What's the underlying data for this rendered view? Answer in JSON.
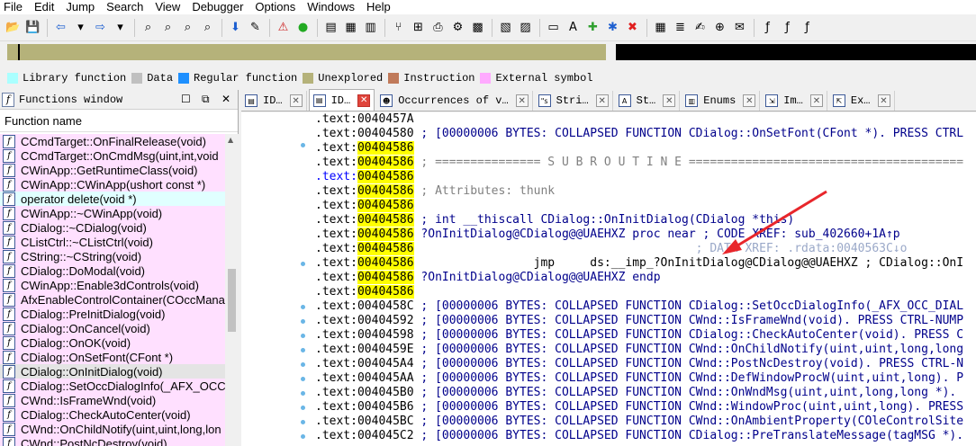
{
  "menu": [
    "File",
    "Edit",
    "Jump",
    "Search",
    "View",
    "Debugger",
    "Options",
    "Windows",
    "Help"
  ],
  "toolbar_icons": [
    "open-icon",
    "save-icon",
    "sep",
    "back-icon",
    "back-dropdown-icon",
    "forward-icon",
    "forward-dropdown-icon",
    "sep",
    "binary-search-icon",
    "text-search-icon",
    "search-next-icon",
    "search-immediate-icon",
    "sep",
    "jump-down-icon",
    "xref-icon",
    "sep",
    "warning-icon",
    "debug-run-icon",
    "sep",
    "hex-view-icon",
    "structures-icon",
    "enums-icon",
    "sep",
    "calls-icon",
    "graph-icon",
    "print-icon",
    "wingraph-icon",
    "colors-icon",
    "sep",
    "strings-view-icon",
    "names-view-icon",
    "sep",
    "add-segment-icon",
    "text-a-icon",
    "patch-icon",
    "add-breakpoint-icon",
    "stop-icon",
    "sep",
    "calculator-icon",
    "list-icon",
    "text-editor-icon",
    "search-plus-icon",
    "note-icon",
    "sep",
    "function-icon",
    "script-icon",
    "python-icon"
  ],
  "legend": [
    {
      "label": "Library function",
      "color": "#aaffff"
    },
    {
      "label": "Data",
      "color": "#c0c0c0"
    },
    {
      "label": "Regular function",
      "color": "#1e90ff"
    },
    {
      "label": "Unexplored",
      "color": "#b5b27a"
    },
    {
      "label": "Instruction",
      "color": "#c07a5a"
    },
    {
      "label": "External symbol",
      "color": "#ffaaff"
    }
  ],
  "functions_window": {
    "title": "Functions window",
    "column_header": "Function name",
    "items": [
      {
        "name": "CCmdTarget::OnFinalRelease(void)",
        "kind": "regular"
      },
      {
        "name": "CCmdTarget::OnCmdMsg(uint,int,void",
        "kind": "regular"
      },
      {
        "name": "CWinApp::GetRuntimeClass(void)",
        "kind": "regular"
      },
      {
        "name": "CWinApp::CWinApp(ushort const *)",
        "kind": "regular"
      },
      {
        "name": "operator delete(void *)",
        "kind": "library"
      },
      {
        "name": "CWinApp::~CWinApp(void)",
        "kind": "regular"
      },
      {
        "name": "CDialog::~CDialog(void)",
        "kind": "regular"
      },
      {
        "name": "CListCtrl::~CListCtrl(void)",
        "kind": "regular"
      },
      {
        "name": "CString::~CString(void)",
        "kind": "regular"
      },
      {
        "name": "CDialog::DoModal(void)",
        "kind": "regular"
      },
      {
        "name": "CWinApp::Enable3dControls(void)",
        "kind": "regular"
      },
      {
        "name": "AfxEnableControlContainer(COccMana",
        "kind": "regular"
      },
      {
        "name": "CDialog::PreInitDialog(void)",
        "kind": "regular"
      },
      {
        "name": "CDialog::OnCancel(void)",
        "kind": "regular"
      },
      {
        "name": "CDialog::OnOK(void)",
        "kind": "regular"
      },
      {
        "name": "CDialog::OnSetFont(CFont *)",
        "kind": "regular"
      },
      {
        "name": "CDialog::OnInitDialog(void)",
        "kind": "selected"
      },
      {
        "name": "CDialog::SetOccDialogInfo(_AFX_OCC_I",
        "kind": "regular"
      },
      {
        "name": "CWnd::IsFrameWnd(void)",
        "kind": "regular"
      },
      {
        "name": "CDialog::CheckAutoCenter(void)",
        "kind": "regular"
      },
      {
        "name": "CWnd::OnChildNotify(uint,uint,long,lon",
        "kind": "regular"
      },
      {
        "name": "CWnd::PostNcDestroy(void)",
        "kind": "regular"
      }
    ]
  },
  "tabs": [
    {
      "label": "ID…",
      "icon": "ida-view-icon",
      "active": false
    },
    {
      "label": "ID…",
      "icon": "ida-view-icon",
      "active": true
    },
    {
      "label": "Occurrences of v…",
      "icon": "occurrences-icon",
      "active": false
    },
    {
      "label": "Stri…",
      "icon": "strings-icon",
      "active": false
    },
    {
      "label": "St…",
      "icon": "structures-icon",
      "active": false
    },
    {
      "label": "Enums",
      "icon": "enums-icon",
      "active": false
    },
    {
      "label": "Im…",
      "icon": "imports-icon",
      "active": false
    },
    {
      "label": "Ex…",
      "icon": "exports-icon",
      "active": false
    }
  ],
  "disassembly": [
    {
      "seg": ".text:",
      "addr": "0040457A",
      "hl": false,
      "segblue": false,
      "bullet": false,
      "code": ""
    },
    {
      "seg": ".text:",
      "addr": "00404580",
      "hl": false,
      "segblue": false,
      "bullet": true,
      "code": " ; [00000006 BYTES: COLLAPSED FUNCTION CDialog::OnSetFont(CFont *). PRESS CTRL"
    },
    {
      "seg": ".text:",
      "addr": "00404586",
      "hl": true,
      "segblue": false,
      "bullet": false,
      "code": ""
    },
    {
      "seg": ".text:",
      "addr": "00404586",
      "hl": true,
      "segblue": false,
      "bullet": false,
      "code": " ; =============== S U B R O U T I N E ======================================="
    },
    {
      "seg": ".text:",
      "addr": "00404586",
      "hl": true,
      "segblue": true,
      "bullet": false,
      "code": ""
    },
    {
      "seg": ".text:",
      "addr": "00404586",
      "hl": true,
      "segblue": false,
      "bullet": false,
      "code": " ; Attributes: thunk"
    },
    {
      "seg": ".text:",
      "addr": "00404586",
      "hl": true,
      "segblue": false,
      "bullet": false,
      "code": ""
    },
    {
      "seg": ".text:",
      "addr": "00404586",
      "hl": true,
      "segblue": false,
      "bullet": false,
      "code": " ; int __thiscall CDialog::OnInitDialog(CDialog *this)"
    },
    {
      "seg": ".text:",
      "addr": "00404586",
      "hl": true,
      "segblue": false,
      "bullet": false,
      "code": " ?OnInitDialog@CDialog@@UAEHXZ proc near ; CODE XREF: sub_402660+1A↑p"
    },
    {
      "seg": ".text:",
      "addr": "00404586",
      "hl": true,
      "segblue": false,
      "bullet": false,
      "code": "                                        ; DATA XREF: .rdata:0040563C↓o"
    },
    {
      "seg": ".text:",
      "addr": "00404586",
      "hl": true,
      "segblue": false,
      "bullet": true,
      "code": "                 jmp     ds:__imp_?OnInitDialog@CDialog@@UAEHXZ ; CDialog::OnI"
    },
    {
      "seg": ".text:",
      "addr": "00404586",
      "hl": true,
      "segblue": false,
      "bullet": false,
      "code": " ?OnInitDialog@CDialog@@UAEHXZ endp"
    },
    {
      "seg": ".text:",
      "addr": "00404586",
      "hl": true,
      "segblue": false,
      "bullet": false,
      "code": ""
    },
    {
      "seg": ".text:",
      "addr": "0040458C",
      "hl": false,
      "segblue": false,
      "bullet": true,
      "code": " ; [00000006 BYTES: COLLAPSED FUNCTION CDialog::SetOccDialogInfo(_AFX_OCC_DIAL"
    },
    {
      "seg": ".text:",
      "addr": "00404592",
      "hl": false,
      "segblue": false,
      "bullet": true,
      "code": " ; [00000006 BYTES: COLLAPSED FUNCTION CWnd::IsFrameWnd(void). PRESS CTRL-NUMP"
    },
    {
      "seg": ".text:",
      "addr": "00404598",
      "hl": false,
      "segblue": false,
      "bullet": true,
      "code": " ; [00000006 BYTES: COLLAPSED FUNCTION CDialog::CheckAutoCenter(void). PRESS C"
    },
    {
      "seg": ".text:",
      "addr": "0040459E",
      "hl": false,
      "segblue": false,
      "bullet": true,
      "code": " ; [00000006 BYTES: COLLAPSED FUNCTION CWnd::OnChildNotify(uint,uint,long,long"
    },
    {
      "seg": ".text:",
      "addr": "004045A4",
      "hl": false,
      "segblue": false,
      "bullet": true,
      "code": " ; [00000006 BYTES: COLLAPSED FUNCTION CWnd::PostNcDestroy(void). PRESS CTRL-N"
    },
    {
      "seg": ".text:",
      "addr": "004045AA",
      "hl": false,
      "segblue": false,
      "bullet": true,
      "code": " ; [00000006 BYTES: COLLAPSED FUNCTION CWnd::DefWindowProcW(uint,uint,long). P"
    },
    {
      "seg": ".text:",
      "addr": "004045B0",
      "hl": false,
      "segblue": false,
      "bullet": true,
      "code": " ; [00000006 BYTES: COLLAPSED FUNCTION CWnd::OnWndMsg(uint,uint,long,long *)."
    },
    {
      "seg": ".text:",
      "addr": "004045B6",
      "hl": false,
      "segblue": false,
      "bullet": true,
      "code": " ; [00000006 BYTES: COLLAPSED FUNCTION CWnd::WindowProc(uint,uint,long). PRESS"
    },
    {
      "seg": ".text:",
      "addr": "004045BC",
      "hl": false,
      "segblue": false,
      "bullet": true,
      "code": " ; [00000006 BYTES: COLLAPSED FUNCTION CWnd::OnAmbientProperty(COleControlSite"
    },
    {
      "seg": ".text:",
      "addr": "004045C2",
      "hl": false,
      "segblue": false,
      "bullet": true,
      "code": " ; [00000006 BYTES: COLLAPSED FUNCTION CDialog::PreTranslateMessage(tagMSG *)."
    }
  ]
}
